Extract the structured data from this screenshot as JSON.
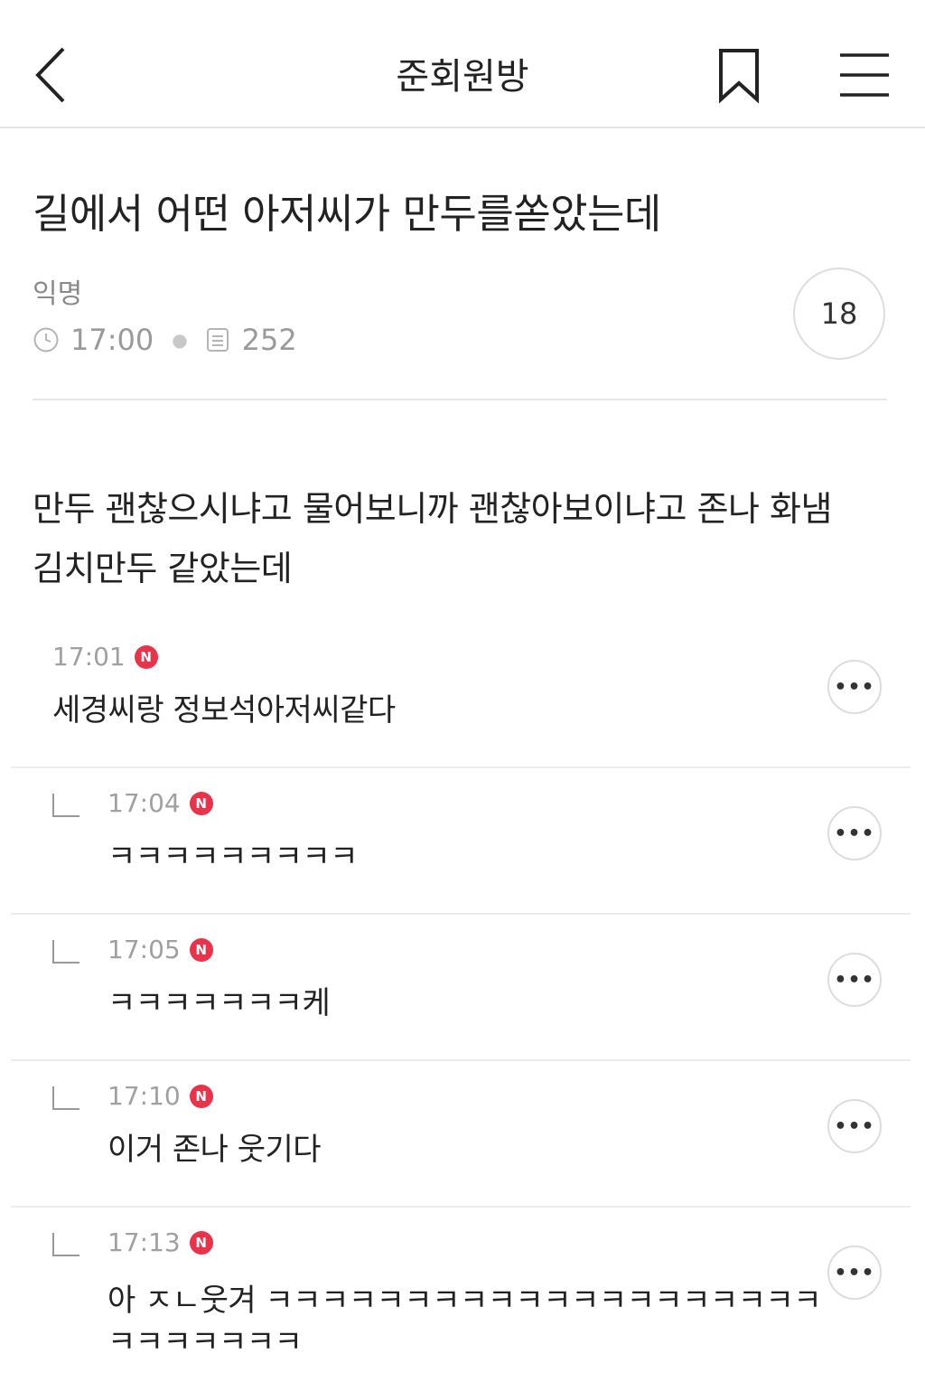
{
  "header": {
    "title": "준회원방",
    "back_icon": "chevron-left-icon",
    "bookmark_icon": "bookmark-icon",
    "menu_icon": "hamburger-menu-icon"
  },
  "post": {
    "title": "길에서 어떤 아저씨가 만두를쏟았는데",
    "author": "익명",
    "time": "17:00",
    "views": "252",
    "comment_count": "18",
    "body": [
      "만두 괜찮으시냐고 물어보니까 괜찮아보이냐고 존나 화냄",
      "김치만두 같았는데"
    ]
  },
  "comments": [
    {
      "time": "17:01",
      "badge": "N",
      "text": "세경씨랑 정보석아저씨같다",
      "reply": false
    },
    {
      "time": "17:04",
      "badge": "N",
      "text": "ㅋㅋㅋㅋㅋㅋㅋㅋㅋ",
      "reply": true
    },
    {
      "time": "17:05",
      "badge": "N",
      "text": "ㅋㅋㅋㅋㅋㅋㅋ케",
      "reply": true
    },
    {
      "time": "17:10",
      "badge": "N",
      "text": "이거 존나 웃기다",
      "reply": true
    },
    {
      "time": "17:13",
      "badge": "N",
      "text": "아 ㅈㄴ웃겨 ㅋㅋㅋㅋㅋㅋㅋㅋㅋㅋㅋㅋㅋㅋㅋㅋㅋㅋㅋㅋㅋㅋㅋㅋㅋㅋㅋ",
      "reply": true
    }
  ],
  "colors": {
    "badge": "#e8334a",
    "divider": "#e6e6e6",
    "meta_text": "#9a9a9a"
  }
}
